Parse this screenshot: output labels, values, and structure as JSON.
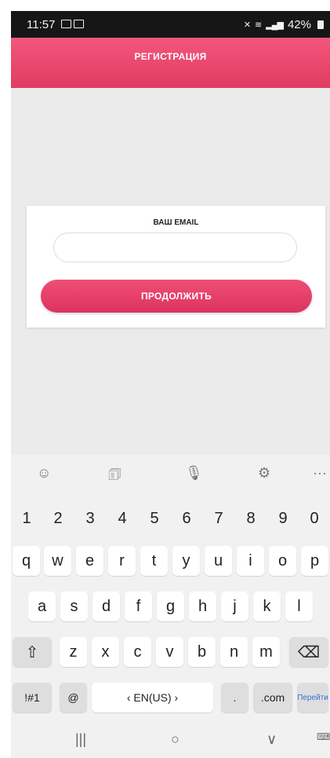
{
  "status_bar": {
    "time": "11:57",
    "battery": "42%"
  },
  "app_bar": {
    "title": "РЕГИСТРАЦИЯ"
  },
  "form": {
    "email_label": "ВАШ EMAIL",
    "email_value": "",
    "continue_label": "ПРОДОЛЖИТЬ"
  },
  "keyboard": {
    "toolbar": {
      "emoji": "☺",
      "sticker": "🗊",
      "mic": "🎙",
      "settings": "⚙",
      "more": "···"
    },
    "numbers": [
      "1",
      "2",
      "3",
      "4",
      "5",
      "6",
      "7",
      "8",
      "9",
      "0"
    ],
    "row1": [
      "q",
      "w",
      "e",
      "r",
      "t",
      "y",
      "u",
      "i",
      "o",
      "p"
    ],
    "row2": [
      "a",
      "s",
      "d",
      "f",
      "g",
      "h",
      "j",
      "k",
      "l"
    ],
    "row3": [
      "z",
      "x",
      "c",
      "v",
      "b",
      "n",
      "m"
    ],
    "shift": "⇧",
    "backspace": "⌫",
    "symbols": "!#1",
    "at": "@",
    "space": "‹   EN(US)   ›",
    "dot": ".",
    "dotcom": ".com",
    "go": "Перейти"
  },
  "nav_bar": {
    "recent": "|||",
    "home": "○",
    "back": "∨",
    "kbd": "⌨"
  }
}
